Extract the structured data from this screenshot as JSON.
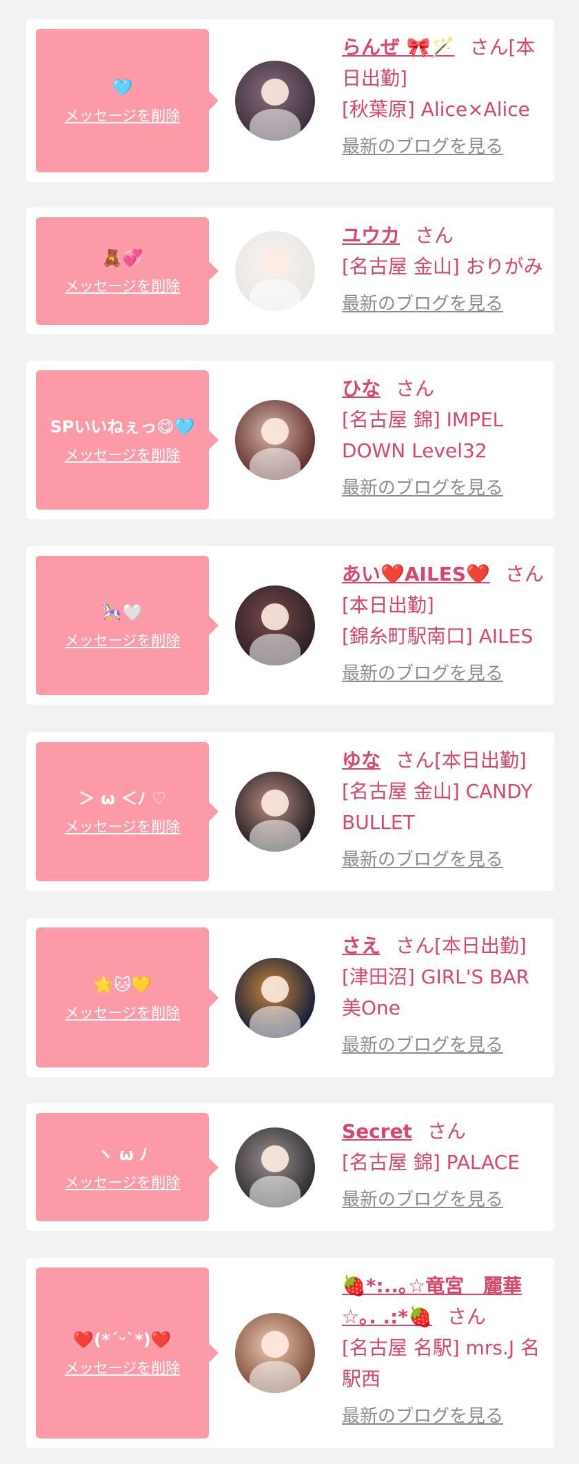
{
  "delete_label": "メッセージを削除",
  "blog_label": "最新のブログを見る",
  "san_label": "さん",
  "items": [
    {
      "message": "🩵",
      "name": "らんぜ 🎀🪄",
      "suffix": "[本日出勤]",
      "shop": "[秋葉原] Alice×Alice",
      "avatar_colors": [
        "#3a2e3a",
        "#8a6b7c"
      ]
    },
    {
      "message": "🧸💞",
      "name": "ユウカ",
      "suffix": "",
      "shop": "[名古屋 金山] おりがみ",
      "avatar_colors": [
        "#e9e6e3",
        "#f7f3ef"
      ]
    },
    {
      "message": "SPいいねぇっ😋🩵",
      "name": "ひな",
      "suffix": "",
      "shop": "[名古屋 錦] IMPEL DOWN Level32",
      "avatar_colors": [
        "#5c2a2a",
        "#d8b6a8"
      ]
    },
    {
      "message": "🎠🤍",
      "name": "あい❤️AILES❤️",
      "suffix": "[本日出勤]",
      "shop": "[錦糸町駅南口] AILES",
      "avatar_colors": [
        "#2a1f22",
        "#7a4a4e"
      ]
    },
    {
      "message": "＞ ω ＜ﾉ ♡",
      "name": "ゆな",
      "suffix": "[本日出勤]",
      "shop": "[名古屋 金山] CANDY BULLET",
      "avatar_colors": [
        "#1e1a1c",
        "#b98c84"
      ]
    },
    {
      "message": "🌟🐱💛",
      "name": "さえ",
      "suffix": "[本日出勤]",
      "shop": "[津田沼] GIRL'S BAR 美One",
      "avatar_colors": [
        "#0f1a3a",
        "#c8873a"
      ]
    },
    {
      "message": "ヽ ω ﾉ",
      "name": "Secret",
      "suffix": "",
      "shop": "[名古屋 錦] PALACE",
      "avatar_colors": [
        "#2c2b2e",
        "#9a9092"
      ]
    },
    {
      "message": "❤️(*´ᵕ`*)❤️",
      "name": "🍓*:..｡☆竜宮　麗華☆｡. .:*🍓",
      "suffix": "",
      "shop": "[名古屋 名駅] mrs.J 名駅西",
      "avatar_colors": [
        "#7a4b36",
        "#f0c9b2"
      ]
    }
  ]
}
